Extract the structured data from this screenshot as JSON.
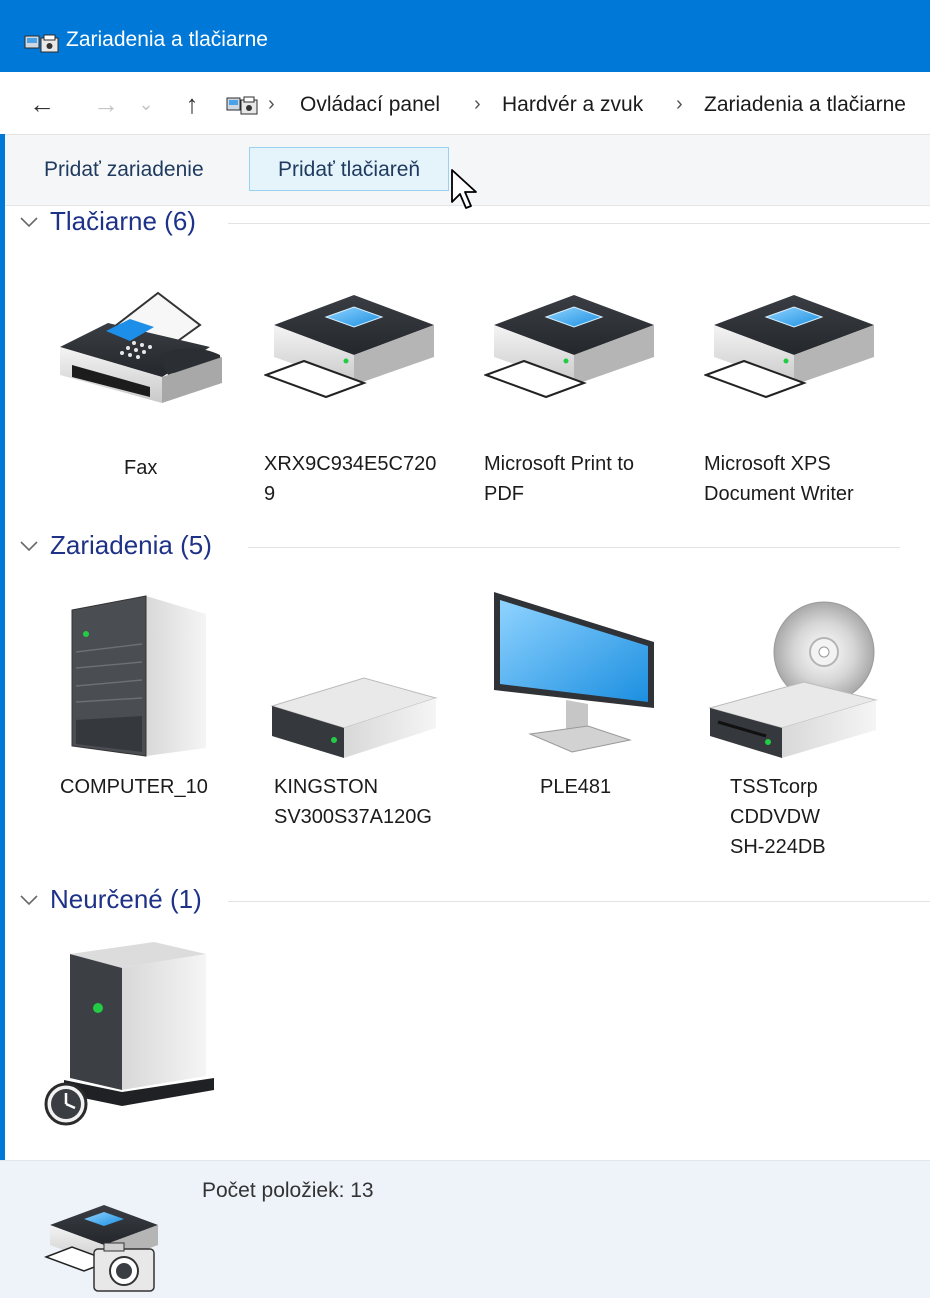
{
  "window": {
    "title": "Zariadenia a tlačiarne"
  },
  "navigation": {
    "back_icon": "←",
    "forward_icon": "→",
    "recent_icon": "⌄",
    "up_icon": "↑",
    "breadcrumb": [
      "Ovládací panel",
      "Hardvér a zvuk",
      "Zariadenia a tlačiarne"
    ],
    "separator": "›"
  },
  "toolbar": {
    "add_device_label": "Pridať zariadenie",
    "add_printer_label": "Pridať tlačiareň"
  },
  "groups": {
    "printers": {
      "label": "Tlačiarne (6)",
      "items": [
        "Fax",
        "XRX9C934E5C720\n9",
        "Microsoft Print to\nPDF",
        "Microsoft XPS\nDocument Writer"
      ]
    },
    "devices": {
      "label": "Zariadenia (5)",
      "items": [
        "COMPUTER_10",
        "KINGSTON\nSV300S37A120G",
        "PLE481",
        "TSSTcorp\nCDDVDW\nSH-224DB"
      ]
    },
    "unspecified": {
      "label": "Neurčené (1)"
    }
  },
  "status": {
    "item_count": "Počet položiek: 13"
  },
  "colors": {
    "titlebar": "#0078d7",
    "group_header": "#1e3287",
    "statusbar": "#eef3fa",
    "toolbar_hover": "#e5f3fb"
  }
}
